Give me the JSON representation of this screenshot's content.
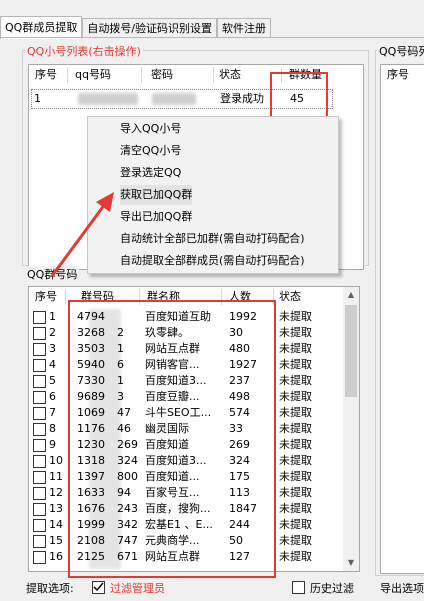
{
  "tabs": [
    {
      "label": "QQ群成员提取"
    },
    {
      "label": "自动拨号/验证码识别设置"
    },
    {
      "label": "软件注册"
    }
  ],
  "qq_list": {
    "title": "QQ小号列表(右击操作)",
    "columns": [
      "序号",
      "qq号码",
      "密码",
      "状态",
      "群数量"
    ],
    "rows": [
      {
        "index": "1",
        "status": "登录成功",
        "group_count": "45"
      }
    ]
  },
  "qq_code_panel": {
    "title": "QQ号码列",
    "columns": [
      "序号"
    ]
  },
  "context_menu": {
    "items": [
      {
        "label": "导入QQ小号"
      },
      {
        "label": "清空QQ小号"
      },
      {
        "label": "登录选定QQ"
      },
      {
        "label": "获取已加QQ群"
      },
      {
        "label": "导出已加QQ群"
      },
      {
        "label": "自动统计全部已加群(需自动打码配合)"
      },
      {
        "label": "自动提取全部群成员(需自动打码配合)"
      }
    ],
    "highlighted": "获取已加QQ群"
  },
  "group_list": {
    "title": "QQ群号码",
    "columns": [
      "序号",
      "群号码",
      "群名称",
      "人数",
      "状态"
    ],
    "rows": [
      {
        "index": "1",
        "num_prefix": "4794",
        "num_suffix": "",
        "name": "百度知道互助",
        "count": "1992",
        "status": "未提取"
      },
      {
        "index": "2",
        "num_prefix": "3268",
        "num_suffix": "2",
        "name": "玖零肆。",
        "count": "30",
        "status": "未提取"
      },
      {
        "index": "3",
        "num_prefix": "3503",
        "num_suffix": "1",
        "name": "网站互点群",
        "count": "480",
        "status": "未提取"
      },
      {
        "index": "4",
        "num_prefix": "5940",
        "num_suffix": "6",
        "name": "网销客官...",
        "count": "1927",
        "status": "未提取"
      },
      {
        "index": "5",
        "num_prefix": "7330",
        "num_suffix": "1",
        "name": "百度知道3...",
        "count": "237",
        "status": "未提取"
      },
      {
        "index": "6",
        "num_prefix": "9689",
        "num_suffix": "3",
        "name": "百度豆瓣...",
        "count": "498",
        "status": "未提取"
      },
      {
        "index": "7",
        "num_prefix": "1069",
        "num_suffix": "47",
        "name": "斗牛SEO工...",
        "count": "574",
        "status": "未提取"
      },
      {
        "index": "8",
        "num_prefix": "1176",
        "num_suffix": "46",
        "name": "幽灵国际",
        "count": "33",
        "status": "未提取"
      },
      {
        "index": "9",
        "num_prefix": "1230",
        "num_suffix": "269",
        "name": "百度知道",
        "count": "269",
        "status": "未提取"
      },
      {
        "index": "10",
        "num_prefix": "1318",
        "num_suffix": "324",
        "name": "百度知道3...",
        "count": "324",
        "status": "未提取"
      },
      {
        "index": "11",
        "num_prefix": "1397",
        "num_suffix": "800",
        "name": "百度知道...",
        "count": "175",
        "status": "未提取"
      },
      {
        "index": "12",
        "num_prefix": "1633",
        "num_suffix": "94",
        "name": "百家号互...",
        "count": "113",
        "status": "未提取"
      },
      {
        "index": "13",
        "num_prefix": "1676",
        "num_suffix": "243",
        "name": "百度，搜狗...",
        "count": "1847",
        "status": "未提取"
      },
      {
        "index": "14",
        "num_prefix": "1999",
        "num_suffix": "342",
        "name": "宏基E1 、E...",
        "count": "244",
        "status": "未提取"
      },
      {
        "index": "15",
        "num_prefix": "2108",
        "num_suffix": "747",
        "name": "元典商学...",
        "count": "50",
        "status": "未提取"
      },
      {
        "index": "16",
        "num_prefix": "2125",
        "num_suffix": "671",
        "name": "网站互点群",
        "count": "127",
        "status": "未提取"
      }
    ]
  },
  "bottom": {
    "extract_options_label": "提取选项:",
    "filter_admin_label": "过滤管理员",
    "history_filter_label": "历史过滤",
    "export_options_label": "导出选项"
  },
  "colors": {
    "accent_red": "#e53935",
    "group_title_red": "#e53935"
  }
}
